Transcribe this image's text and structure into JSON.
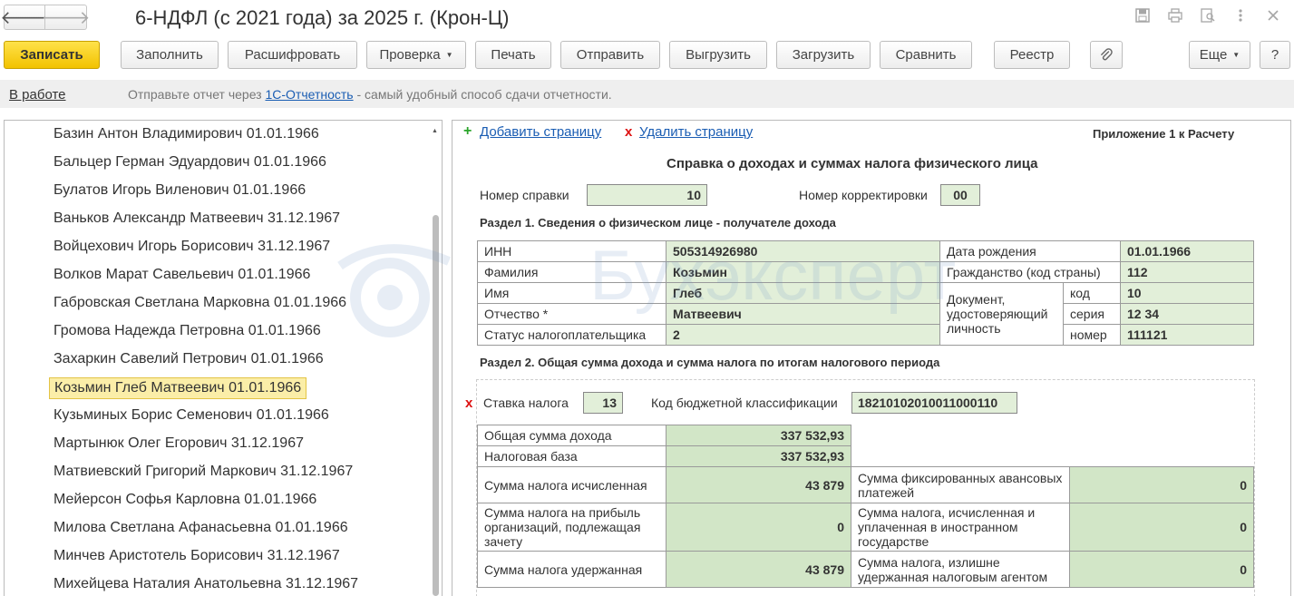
{
  "window": {
    "title": "6-НДФЛ (с 2021 года) за 2025 г. (Крон-Ц)",
    "nav_back": "🡐",
    "nav_forward": "🡒",
    "icons": [
      "save-icon",
      "print-icon",
      "search-icon",
      "more-vertical-icon",
      "close-icon"
    ]
  },
  "toolbar": {
    "save": "Записать",
    "fill": "Заполнить",
    "decode": "Расшифровать",
    "check": "Проверка",
    "print": "Печать",
    "send": "Отправить",
    "export": "Выгрузить",
    "import": "Загрузить",
    "compare": "Сравнить",
    "registry": "Реестр",
    "more": "Еще",
    "help": "?"
  },
  "infobar": {
    "status": "В работе",
    "text_before": "Отправьте отчет через ",
    "link": "1С-Отчетность",
    "text_after": " - самый удобный способ сдачи отчетности."
  },
  "employees": [
    "Базин Антон Владимирович 01.01.1966",
    "Бальцер Герман Эдуардович 01.01.1966",
    "Булатов Игорь Виленович 01.01.1966",
    "Ваньков Александр Матвеевич 31.12.1967",
    "Войцехович Игорь Борисович 31.12.1967",
    "Волков Марат Савельевич 01.01.1966",
    "Габровская Светлана Марковна 01.01.1966",
    "Громова Надежда Петровна 01.01.1966",
    "Захаркин Савелий Петрович 01.01.1966",
    "Козьмин Глеб Матвеевич 01.01.1966",
    "Кузьминых Борис Семенович 01.01.1966",
    "Мартынюк Олег Егорович 31.12.1967",
    "Матвиевский Григорий Маркович 31.12.1967",
    "Мейерсон Софья Карловна 01.01.1966",
    "Милова Светлана Афанасьевна 01.01.1966",
    "Минчев Аристотель Борисович 31.12.1967",
    "Михейцева Наталия Анатольевна 31.12.1967"
  ],
  "selected_employee_index": 9,
  "form": {
    "add_page": "Добавить страницу",
    "delete_page": "Удалить страницу",
    "appendix": "Приложение 1 к Расчету",
    "heading": "Справка о доходах и суммах налога физического лица",
    "cert_number_label": "Номер справки",
    "cert_number": "10",
    "correction_label": "Номер корректировки",
    "correction": "00",
    "section1_title": "Раздел 1. Сведения о физическом лице - получателе дохода",
    "inn_label": "ИНН",
    "inn": "505314926980",
    "birth_label": "Дата рождения",
    "birth": "01.01.1966",
    "lastname_label": "Фамилия",
    "lastname": "Козьмин",
    "citizenship_label": "Гражданство (код страны)",
    "citizenship": "112",
    "firstname_label": "Имя",
    "firstname": "Глеб",
    "doc_label": "Документ, удостоверяющий личность",
    "doc_code_label": "код",
    "doc_code": "10",
    "patronymic_label": "Отчество *",
    "patronymic": "Матвеевич",
    "doc_series_label": "серия",
    "doc_series": "12 34",
    "taxpayer_status_label": "Статус налогоплательщика",
    "taxpayer_status": "2",
    "doc_number_label": "номер",
    "doc_number": "111121",
    "section2_title": "Раздел 2. Общая сумма дохода и сумма налога по итогам налогового периода",
    "rate_label": "Ставка налога",
    "rate": "13",
    "kbk_label": "Код бюджетной классификации",
    "kbk": "18210102010011000110",
    "total_income_label": "Общая сумма дохода",
    "total_income": "337 532,93",
    "tax_base_label": "Налоговая база",
    "tax_base": "337 532,93",
    "tax_calc_label": "Сумма налога исчисленная",
    "tax_calc": "43 879",
    "fixed_adv_label": "Сумма фиксированных авансовых платежей",
    "fixed_adv": "0",
    "profit_tax_label": "Сумма налога на прибыль организаций, подлежащая зачету",
    "profit_tax": "0",
    "foreign_tax_label": "Сумма налога, исчисленная и уплаченная в иностранном государстве",
    "foreign_tax": "0",
    "tax_withheld_label": "Сумма налога удержанная",
    "tax_withheld": "43 879",
    "over_withheld_label": "Сумма налога, излишне удержанная налоговым агентом",
    "over_withheld": "0"
  },
  "watermark": "Бухэксперт"
}
